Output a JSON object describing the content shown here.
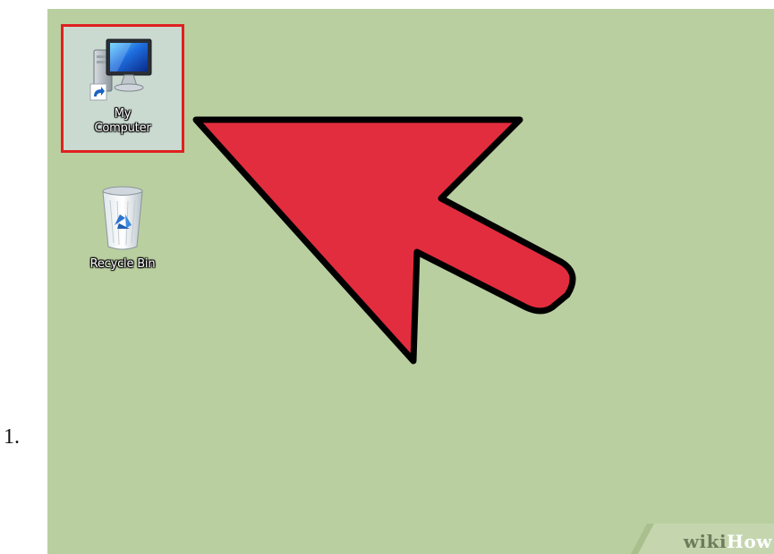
{
  "step": {
    "number": "1."
  },
  "desktop": {
    "background_color": "#b9cfa0",
    "icons": [
      {
        "label_line1": "My",
        "label_line2": "Computer",
        "icon": "computer-icon",
        "shortcut": true,
        "selected": true
      },
      {
        "label": "Recycle Bin",
        "icon": "recycle-bin-icon",
        "selected": false
      }
    ]
  },
  "annotation": {
    "type": "arrow",
    "color": "#e22d3f",
    "outline_color": "#000000",
    "points_to": "My Computer"
  },
  "highlight": {
    "color": "#e02020"
  },
  "watermark": {
    "part1": "wiki",
    "part2": "How"
  }
}
